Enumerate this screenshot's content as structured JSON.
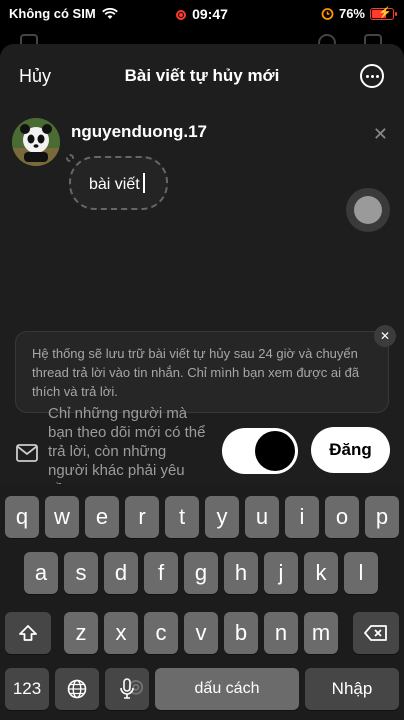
{
  "status_bar": {
    "carrier": "Không có SIM",
    "time": "09:47",
    "battery": "76%",
    "battery_level": 0.76
  },
  "header": {
    "cancel_label": "Hủy",
    "title": "Bài viết tự hủy mới"
  },
  "post": {
    "username": "nguyenduong.17",
    "text": "bài viết"
  },
  "notice": {
    "text": "Hệ thống sẽ lưu trữ bài viết tự hủy sau 24 giờ và chuyển thread trả lời vào tin nhắn. Chỉ mình bạn xem được ai đã thích và trả lời."
  },
  "reply_settings": {
    "text": "Chỉ những người mà bạn theo dõi mới có thể trả lời, còn những người khác phải yêu cầu."
  },
  "actions": {
    "post_label": "Đăng"
  },
  "keyboard": {
    "row1": [
      "q",
      "w",
      "e",
      "r",
      "t",
      "y",
      "u",
      "i",
      "o",
      "p"
    ],
    "row2": [
      "a",
      "s",
      "d",
      "f",
      "g",
      "h",
      "j",
      "k",
      "l"
    ],
    "row3": [
      "z",
      "x",
      "c",
      "v",
      "b",
      "n",
      "m"
    ],
    "numbers_label": "123",
    "space_label": "dấu cách",
    "return_label": "Nhập"
  }
}
